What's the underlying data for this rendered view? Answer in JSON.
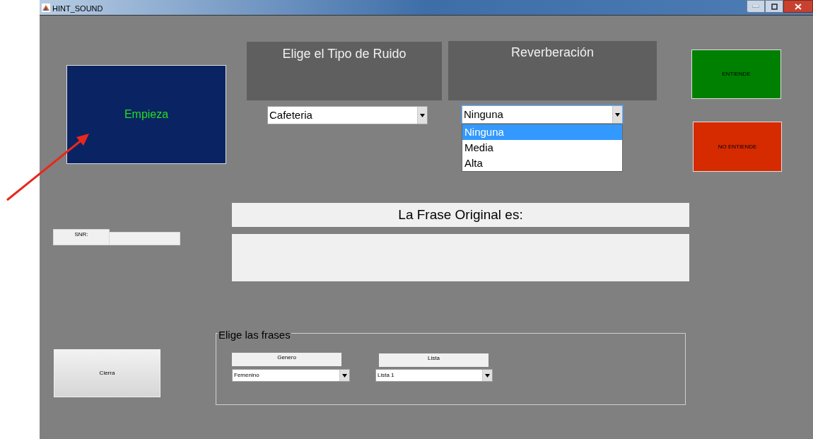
{
  "window": {
    "title": "HINT_SOUND"
  },
  "start_button": {
    "label": "Empieza"
  },
  "noise_panel": {
    "title": "Elige el Tipo de Ruido",
    "value": "Cafeteria"
  },
  "reverb_panel": {
    "title": "Reverberación",
    "value": "Ninguna",
    "expanded": true,
    "options": [
      {
        "label": "Ninguna",
        "selected": true
      },
      {
        "label": "Media",
        "selected": false
      },
      {
        "label": "Alta",
        "selected": false
      }
    ]
  },
  "understands_button": {
    "label": "ENTIENDE"
  },
  "not_understands_button": {
    "label": "NO ENTIENDE"
  },
  "snr": {
    "label": "SNR:"
  },
  "original_sentence": {
    "title": "La Frase Original es:"
  },
  "close_button": {
    "label": "Cierra"
  },
  "sentences_group": {
    "title": "Elige las frases",
    "gender": {
      "label": "Genero",
      "value": "Femenino"
    },
    "list": {
      "label": "Lista",
      "value": "Lista 1"
    }
  }
}
